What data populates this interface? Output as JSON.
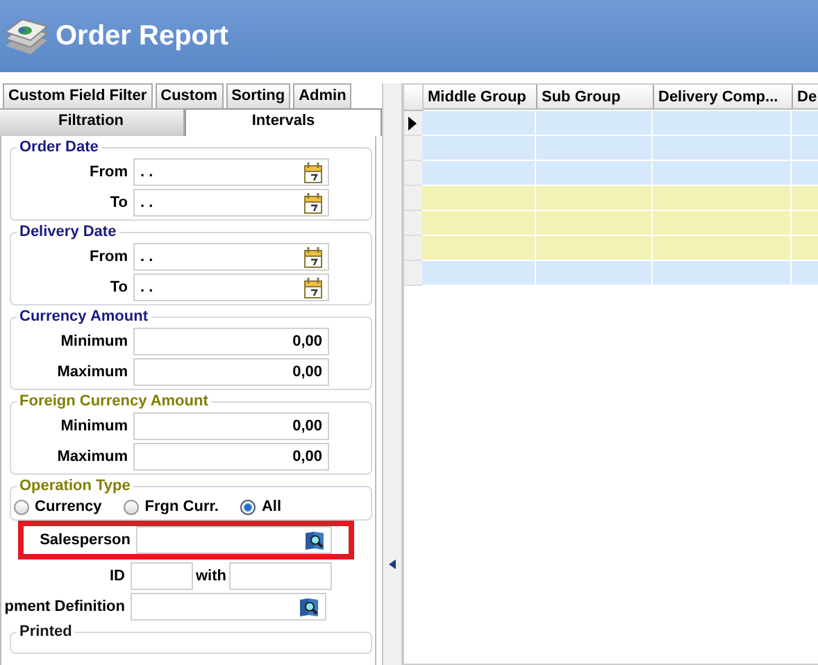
{
  "window": {
    "title": "Order Report"
  },
  "tabs_row_1": [
    {
      "label": "Custom Field Filter",
      "selected": false
    },
    {
      "label": "Custom",
      "selected": false
    },
    {
      "label": "Sorting",
      "selected": false
    },
    {
      "label": "Admin",
      "selected": false
    }
  ],
  "tabs_row_2": [
    {
      "label": "Filtration",
      "selected": false
    },
    {
      "label": "Intervals",
      "selected": true
    }
  ],
  "sections": [
    {
      "kind": "dates",
      "title": "Order Date",
      "color": "#1a1a80",
      "fields": [
        {
          "label": "From",
          "value": ". ."
        },
        {
          "label": "To",
          "value": ". ."
        }
      ]
    },
    {
      "kind": "dates",
      "title": "Delivery Date",
      "color": "#1a1a80",
      "fields": [
        {
          "label": "From",
          "value": ". ."
        },
        {
          "label": "To",
          "value": ". ."
        }
      ]
    },
    {
      "kind": "amounts",
      "title": "Currency Amount",
      "color": "#1a1a80",
      "fields": [
        {
          "label": "Minimum",
          "value": "0,00"
        },
        {
          "label": "Maximum",
          "value": "0,00"
        }
      ]
    },
    {
      "kind": "amounts",
      "title": "Foreign Currency Amount",
      "color": "#808000",
      "fields": [
        {
          "label": "Minimum",
          "value": "0,00"
        },
        {
          "label": "Maximum",
          "value": "0,00"
        }
      ]
    },
    {
      "kind": "radios",
      "title": "Operation Type",
      "color": "#808000",
      "options": [
        {
          "label": "Currency",
          "selected": false
        },
        {
          "label": "Frgn Curr.",
          "selected": false
        },
        {
          "label": "All",
          "selected": true
        }
      ]
    },
    {
      "kind": "lookup",
      "label": "Salesperson",
      "highlighted": true
    },
    {
      "kind": "range",
      "label": "ID",
      "with_label": "with"
    },
    {
      "kind": "lookup",
      "label": "pment Definition",
      "highlighted": false
    },
    {
      "kind": "title",
      "title": "Printed",
      "color": "#1a1a1a"
    }
  ],
  "grid": {
    "columns": [
      "Middle Group",
      "Sub Group",
      "Delivery Comp...",
      "De"
    ],
    "rows": [
      {
        "color": "#d6e9fc",
        "selected": true
      },
      {
        "color": "#d6e9fc",
        "selected": false
      },
      {
        "color": "#d6e9fc",
        "selected": false
      },
      {
        "color": "#f2f2b4",
        "selected": false
      },
      {
        "color": "#f2f2b4",
        "selected": false
      },
      {
        "color": "#f2f2b4",
        "selected": false
      },
      {
        "color": "#d6e9fc",
        "selected": false
      }
    ]
  }
}
